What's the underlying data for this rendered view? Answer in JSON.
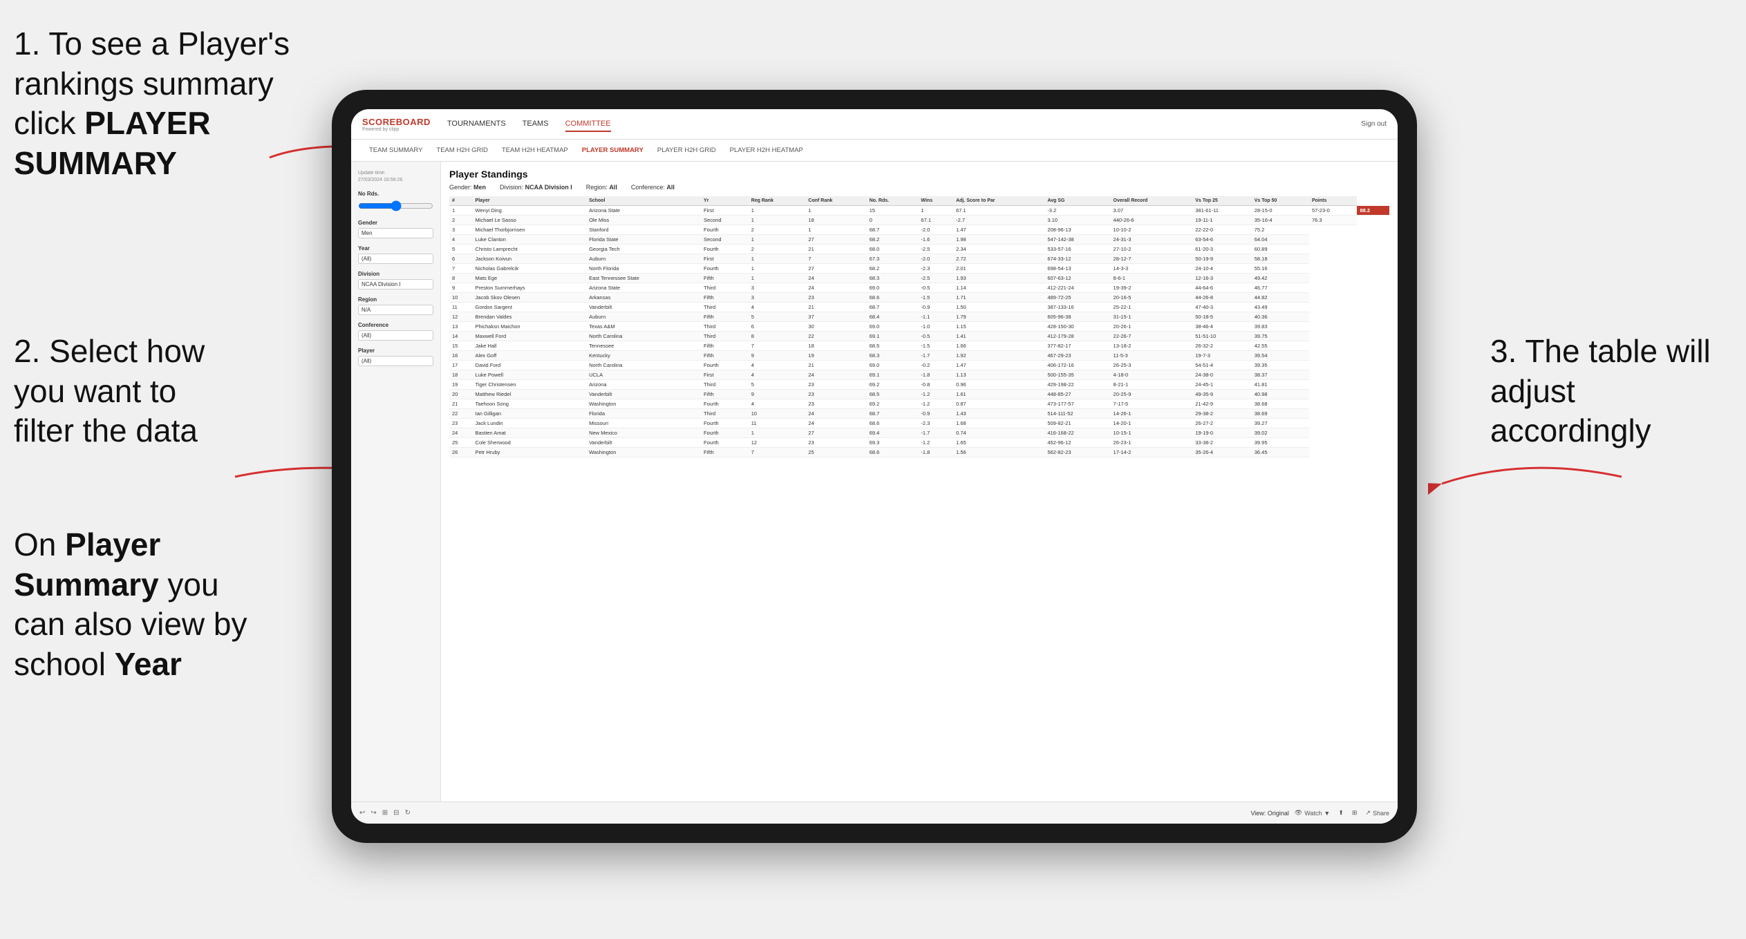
{
  "instructions": {
    "step1": "1. To see a Player's rankings summary click ",
    "step1_bold": "PLAYER SUMMARY",
    "step2_title": "2. Select how you want to filter the data",
    "step3_title": "3. The table will adjust accordingly",
    "on_player_summary": "On ",
    "player_summary_bold": "Player Summary",
    "on_player_summary_2": " you can also view by school ",
    "year_bold": "Year"
  },
  "nav": {
    "logo": "SCOREBOARD",
    "logo_sub": "Powered by clipp",
    "links": [
      "TOURNAMENTS",
      "TEAMS",
      "COMMITTEE"
    ],
    "sign_out": "Sign out"
  },
  "subnav": {
    "links": [
      "TEAM SUMMARY",
      "TEAM H2H GRID",
      "TEAM H2H HEATMAP",
      "PLAYER SUMMARY",
      "PLAYER H2H GRID",
      "PLAYER H2H HEATMAP"
    ]
  },
  "sidebar": {
    "update_label": "Update time:",
    "update_time": "27/03/2024 16:56:26",
    "no_rds_label": "No Rds.",
    "gender_label": "Gender",
    "gender_value": "Men",
    "year_label": "Year",
    "year_value": "(All)",
    "division_label": "Division",
    "division_value": "NCAA Division I",
    "region_label": "Region",
    "region_value": "N/A",
    "conference_label": "Conference",
    "conference_value": "(All)",
    "player_label": "Player",
    "player_value": "(All)"
  },
  "table": {
    "title": "Player Standings",
    "gender_label": "Gender:",
    "gender_value": "Men",
    "division_label": "Division:",
    "division_value": "NCAA Division I",
    "region_label": "Region:",
    "region_value": "All",
    "conference_label": "Conference:",
    "conference_value": "All",
    "columns": [
      "#",
      "Player",
      "School",
      "Yr",
      "Reg Rank",
      "Conf Rank",
      "No. Rds.",
      "Wins",
      "Adj. Score to Par",
      "Avg SG",
      "Overall Record",
      "Vs Top 25",
      "Vs Top 50",
      "Points"
    ],
    "rows": [
      [
        "1",
        "Wenyi Ding",
        "Arizona State",
        "First",
        "1",
        "1",
        "15",
        "1",
        "67.1",
        "-3.2",
        "3.07",
        "381-61-11",
        "28-15-0",
        "57-23-0",
        "88.2"
      ],
      [
        "2",
        "Michael Le Sasso",
        "Ole Miss",
        "Second",
        "1",
        "18",
        "0",
        "67.1",
        "-2.7",
        "3.10",
        "440-26-6",
        "19-11-1",
        "35-16-4",
        "76.3"
      ],
      [
        "3",
        "Michael Thorbjornsen",
        "Stanford",
        "Fourth",
        "2",
        "1",
        "68.7",
        "-2.0",
        "1.47",
        "208-96-13",
        "10-10-2",
        "22-22-0",
        "75.2"
      ],
      [
        "4",
        "Luke Clanton",
        "Florida State",
        "Second",
        "1",
        "27",
        "68.2",
        "-1.6",
        "1.98",
        "547-142-38",
        "24-31-3",
        "63-54-6",
        "64.04"
      ],
      [
        "5",
        "Christo Lamprecht",
        "Georgia Tech",
        "Fourth",
        "2",
        "21",
        "68.0",
        "-2.5",
        "2.34",
        "533-57-16",
        "27-10-2",
        "61-20-3",
        "60.89"
      ],
      [
        "6",
        "Jackson Koivun",
        "Auburn",
        "First",
        "1",
        "7",
        "67.3",
        "-2.0",
        "2.72",
        "674-33-12",
        "28-12-7",
        "50-19-9",
        "58.18"
      ],
      [
        "7",
        "Nicholas Gabrelcik",
        "North Florida",
        "Fourth",
        "1",
        "27",
        "68.2",
        "-2.3",
        "2.01",
        "698-54-13",
        "14-3-3",
        "24-10-4",
        "55.16"
      ],
      [
        "8",
        "Mats Ege",
        "East Tennessee State",
        "Fifth",
        "1",
        "24",
        "68.3",
        "-2.5",
        "1.93",
        "607-63-12",
        "8-6-1",
        "12-16-3",
        "49.42"
      ],
      [
        "9",
        "Preston Summerhays",
        "Arizona State",
        "Third",
        "3",
        "24",
        "69.0",
        "-0.5",
        "1.14",
        "412-221-24",
        "19-39-2",
        "44-64-6",
        "46.77"
      ],
      [
        "10",
        "Jacob Skov Olesen",
        "Arkansas",
        "Fifth",
        "3",
        "23",
        "68.6",
        "-1.5",
        "1.71",
        "489-72-25",
        "20-16-5",
        "44-26-8",
        "44.82"
      ],
      [
        "11",
        "Gordon Sargent",
        "Vanderbilt",
        "Third",
        "4",
        "21",
        "68.7",
        "-0.9",
        "1.50",
        "387-133-16",
        "25-22-1",
        "47-40-3",
        "43.49"
      ],
      [
        "12",
        "Brendan Valdes",
        "Auburn",
        "Fifth",
        "5",
        "37",
        "68.4",
        "-1.1",
        "1.79",
        "605-96-38",
        "31-15-1",
        "50-18-5",
        "40.36"
      ],
      [
        "13",
        "Phichaksn Maichon",
        "Texas A&M",
        "Third",
        "6",
        "30",
        "69.0",
        "-1.0",
        "1.15",
        "428-150-30",
        "20-26-1",
        "38-46-4",
        "39.83"
      ],
      [
        "14",
        "Maxwell Ford",
        "North Carolina",
        "Third",
        "8",
        "22",
        "69.1",
        "-0.5",
        "1.41",
        "412-179-28",
        "22-26-7",
        "51-51-10",
        "39.75"
      ],
      [
        "15",
        "Jake Hall",
        "Tennessee",
        "Fifth",
        "7",
        "18",
        "68.5",
        "-1.5",
        "1.66",
        "377-82-17",
        "13-18-2",
        "26-32-2",
        "42.55"
      ],
      [
        "16",
        "Alex Goff",
        "Kentucky",
        "Fifth",
        "9",
        "19",
        "68.3",
        "-1.7",
        "1.92",
        "467-29-23",
        "11-5-3",
        "19-7-3",
        "39.54"
      ],
      [
        "17",
        "David Ford",
        "North Carolina",
        "Fourth",
        "4",
        "21",
        "69.0",
        "-0.2",
        "1.47",
        "406-172-16",
        "26-25-3",
        "54-51-4",
        "39.35"
      ],
      [
        "18",
        "Luke Powell",
        "UCLA",
        "First",
        "4",
        "24",
        "69.1",
        "-1.8",
        "1.13",
        "500-155-35",
        "4-18-0",
        "24-38-0",
        "38.37"
      ],
      [
        "19",
        "Tiger Christensen",
        "Arizona",
        "Third",
        "5",
        "23",
        "69.2",
        "-0.8",
        "0.96",
        "429-198-22",
        "8-21-1",
        "24-45-1",
        "41.81"
      ],
      [
        "20",
        "Matthew Riedel",
        "Vanderbilt",
        "Fifth",
        "9",
        "23",
        "68.5",
        "-1.2",
        "1.61",
        "448-85-27",
        "20-25-9",
        "49-35-9",
        "40.98"
      ],
      [
        "21",
        "Taehoon Song",
        "Washington",
        "Fourth",
        "4",
        "23",
        "69.2",
        "-1.2",
        "0.87",
        "473-177-57",
        "7-17-5",
        "21-42-9",
        "38.68"
      ],
      [
        "22",
        "Ian Gilligan",
        "Florida",
        "Third",
        "10",
        "24",
        "68.7",
        "-0.9",
        "1.43",
        "514-111-52",
        "14-26-1",
        "29-38-2",
        "38.69"
      ],
      [
        "23",
        "Jack Lundin",
        "Missouri",
        "Fourth",
        "11",
        "24",
        "68.6",
        "-2.3",
        "1.68",
        "509-82-21",
        "14-20-1",
        "26-27-2",
        "39.27"
      ],
      [
        "24",
        "Bastien Amat",
        "New Mexico",
        "Fourth",
        "1",
        "27",
        "69.4",
        "-1.7",
        "0.74",
        "416-168-22",
        "10-15-1",
        "19-19-0",
        "39.02"
      ],
      [
        "25",
        "Cole Sherwood",
        "Vanderbilt",
        "Fourth",
        "12",
        "23",
        "69.3",
        "-1.2",
        "1.65",
        "452-96-12",
        "26-23-1",
        "33-38-2",
        "39.95"
      ],
      [
        "26",
        "Petr Hruby",
        "Washington",
        "Fifth",
        "7",
        "25",
        "68.6",
        "-1.8",
        "1.56",
        "562-82-23",
        "17-14-2",
        "35-26-4",
        "36.45"
      ]
    ]
  },
  "bottombar": {
    "view_label": "View: Original",
    "watch_label": "Watch",
    "share_label": "Share"
  }
}
